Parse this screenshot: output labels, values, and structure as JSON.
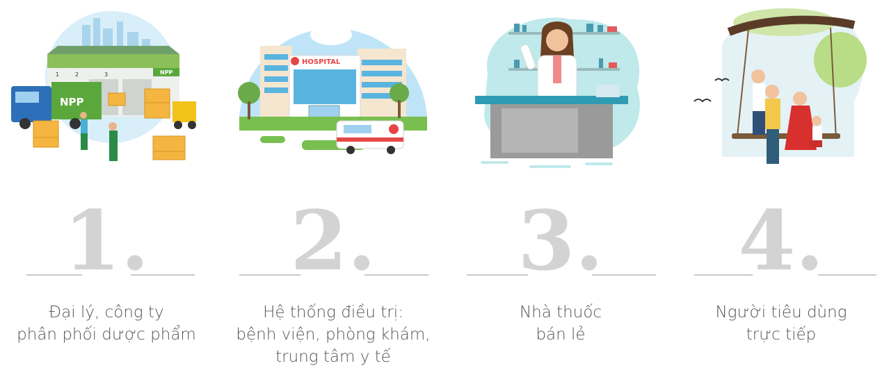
{
  "steps": [
    {
      "number": "1.",
      "caption": [
        "Đại lý, công ty",
        "phân phối dược phẩm"
      ],
      "illustration": "warehouse-distribution-illustration",
      "truck_logo": "NPP",
      "building_logo": "NPP",
      "dock_numbers": [
        "1",
        "2",
        "3"
      ]
    },
    {
      "number": "2.",
      "caption": [
        "Hệ thống điều trị:",
        "bệnh viện, phòng khám,",
        "trung tâm y tế"
      ],
      "illustration": "hospital-illustration",
      "sign": "HOSPITAL"
    },
    {
      "number": "3.",
      "caption": [
        "Nhà thuốc",
        "bán lẻ"
      ],
      "illustration": "pharmacist-illustration"
    },
    {
      "number": "4.",
      "caption": [
        "Người tiêu dùng",
        "trực tiếp"
      ],
      "illustration": "family-swing-illustration"
    }
  ],
  "colors": {
    "number": "#d3d3d3",
    "caption_text": "#555555",
    "divider": "#c9c9c9",
    "sky": "#bfe4f7",
    "green": "#5aa83c"
  }
}
